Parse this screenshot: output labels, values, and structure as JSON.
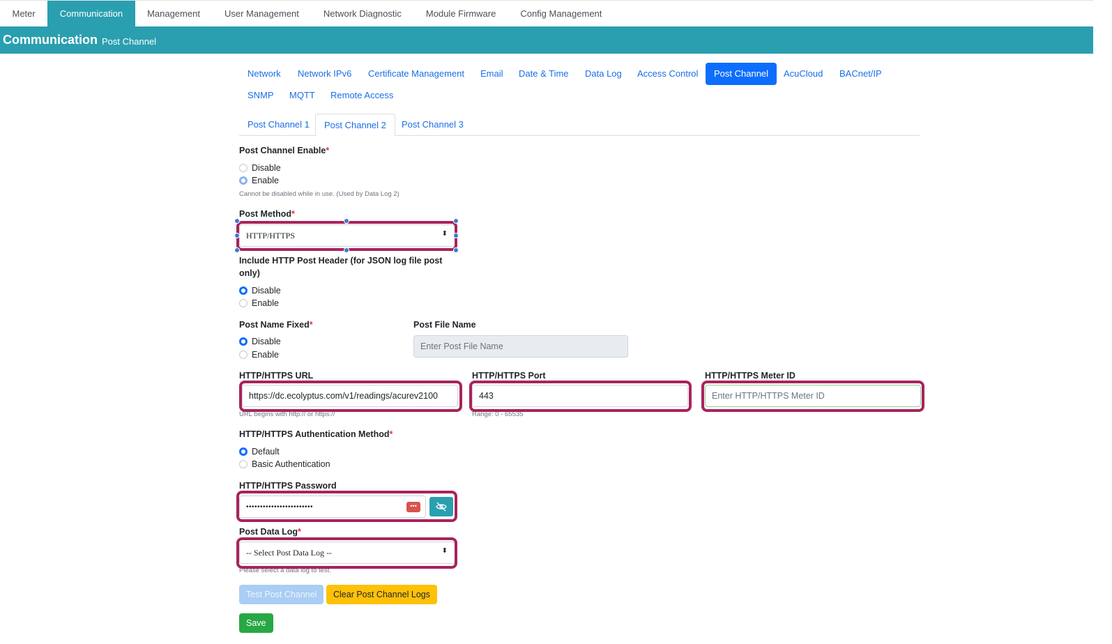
{
  "topnav": {
    "items": [
      "Meter",
      "Communication",
      "Management",
      "User Management",
      "Network Diagnostic",
      "Module Firmware",
      "Config Management"
    ],
    "active": "Communication"
  },
  "banner": {
    "title": "Communication",
    "subtitle": "Post Channel"
  },
  "pills": {
    "items": [
      "Network",
      "Network IPv6",
      "Certificate Management",
      "Email",
      "Date & Time",
      "Data Log",
      "Access Control",
      "Post Channel",
      "AcuCloud",
      "BACnet/IP",
      "SNMP",
      "MQTT",
      "Remote Access"
    ],
    "active": "Post Channel"
  },
  "subtabs": {
    "items": [
      "Post Channel 1",
      "Post Channel 2",
      "Post Channel 3"
    ],
    "active": "Post Channel 2"
  },
  "form": {
    "enable": {
      "label": "Post Channel Enable",
      "required": "*",
      "options": [
        "Disable",
        "Enable"
      ],
      "selected": "Enable",
      "help": "Cannot be disabled while in use. (Used by Data Log 2)"
    },
    "method": {
      "label": "Post Method",
      "required": "*",
      "value": "HTTP/HTTPS",
      "caret": "⬍"
    },
    "header": {
      "label_line1": "Include HTTP Post Header (for JSON log file post",
      "label_line2": "only)",
      "options": [
        "Disable",
        "Enable"
      ],
      "selected": "Disable"
    },
    "name_fixed": {
      "label": "Post Name Fixed",
      "required": "*",
      "options": [
        "Disable",
        "Enable"
      ],
      "selected": "Disable"
    },
    "file_name": {
      "label": "Post File Name",
      "placeholder": "Enter Post File Name"
    },
    "url": {
      "label": "HTTP/HTTPS URL",
      "value": "https://dc.ecolyptus.com/v1/readings/acurev2100",
      "help": "URL begins with http:// or https://"
    },
    "port": {
      "label": "HTTP/HTTPS Port",
      "value": "443",
      "help": "Range: 0 - 65535"
    },
    "meter_id": {
      "label": "HTTP/HTTPS Meter ID",
      "placeholder": "Enter HTTP/HTTPS Meter ID"
    },
    "auth": {
      "label": "HTTP/HTTPS Authentication Method",
      "required": "*",
      "options": [
        "Default",
        "Basic Authentication"
      ],
      "selected": "Default"
    },
    "password": {
      "label": "HTTP/HTTPS Password",
      "value": "••••••••••••••••••••••••",
      "key_icon": "•••"
    },
    "data_log": {
      "label": "Post Data Log",
      "required": "*",
      "value": "-- Select Post Data Log --",
      "help": "Please select a data log to test."
    }
  },
  "buttons": {
    "test": "Test Post Channel",
    "clear": "Clear Post Channel Logs",
    "save": "Save"
  },
  "colors": {
    "teal": "#2a9fb0",
    "primary": "#0d6efd",
    "highlight": "#a8245b",
    "warning": "#ffc107",
    "success": "#28a745"
  },
  "icons": {
    "eye": "eye-slash-icon",
    "key": "password-manager-icon",
    "caret": "select-caret-icon"
  }
}
